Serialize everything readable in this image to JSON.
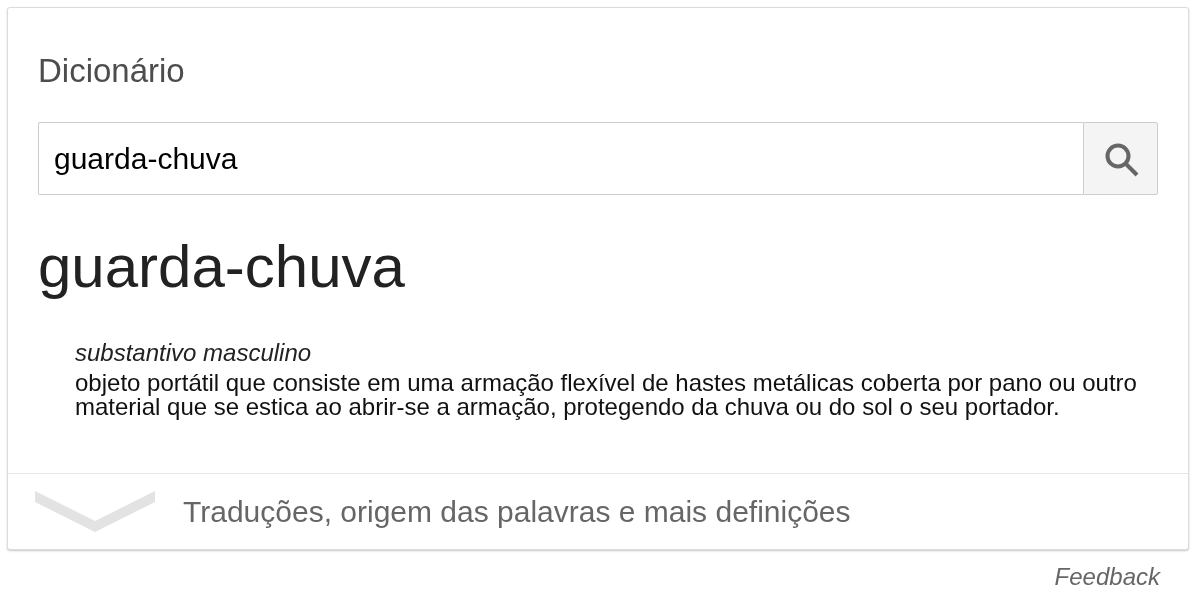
{
  "card": {
    "title": "Dicionário",
    "search": {
      "value": "guarda-chuva"
    },
    "headword": "guarda-chuva",
    "senses": [
      {
        "part_of_speech": "substantivo masculino",
        "definition": "objeto portátil que consiste em uma armação flexível de hastes metálicas coberta por pano ou outro material que se estica ao abrir-se a armação, protegendo da chuva ou do sol o seu portador."
      }
    ],
    "more": {
      "label": "Traduções, origem das palavras e mais definições",
      "expanded": false
    }
  },
  "feedback": "Feedback"
}
